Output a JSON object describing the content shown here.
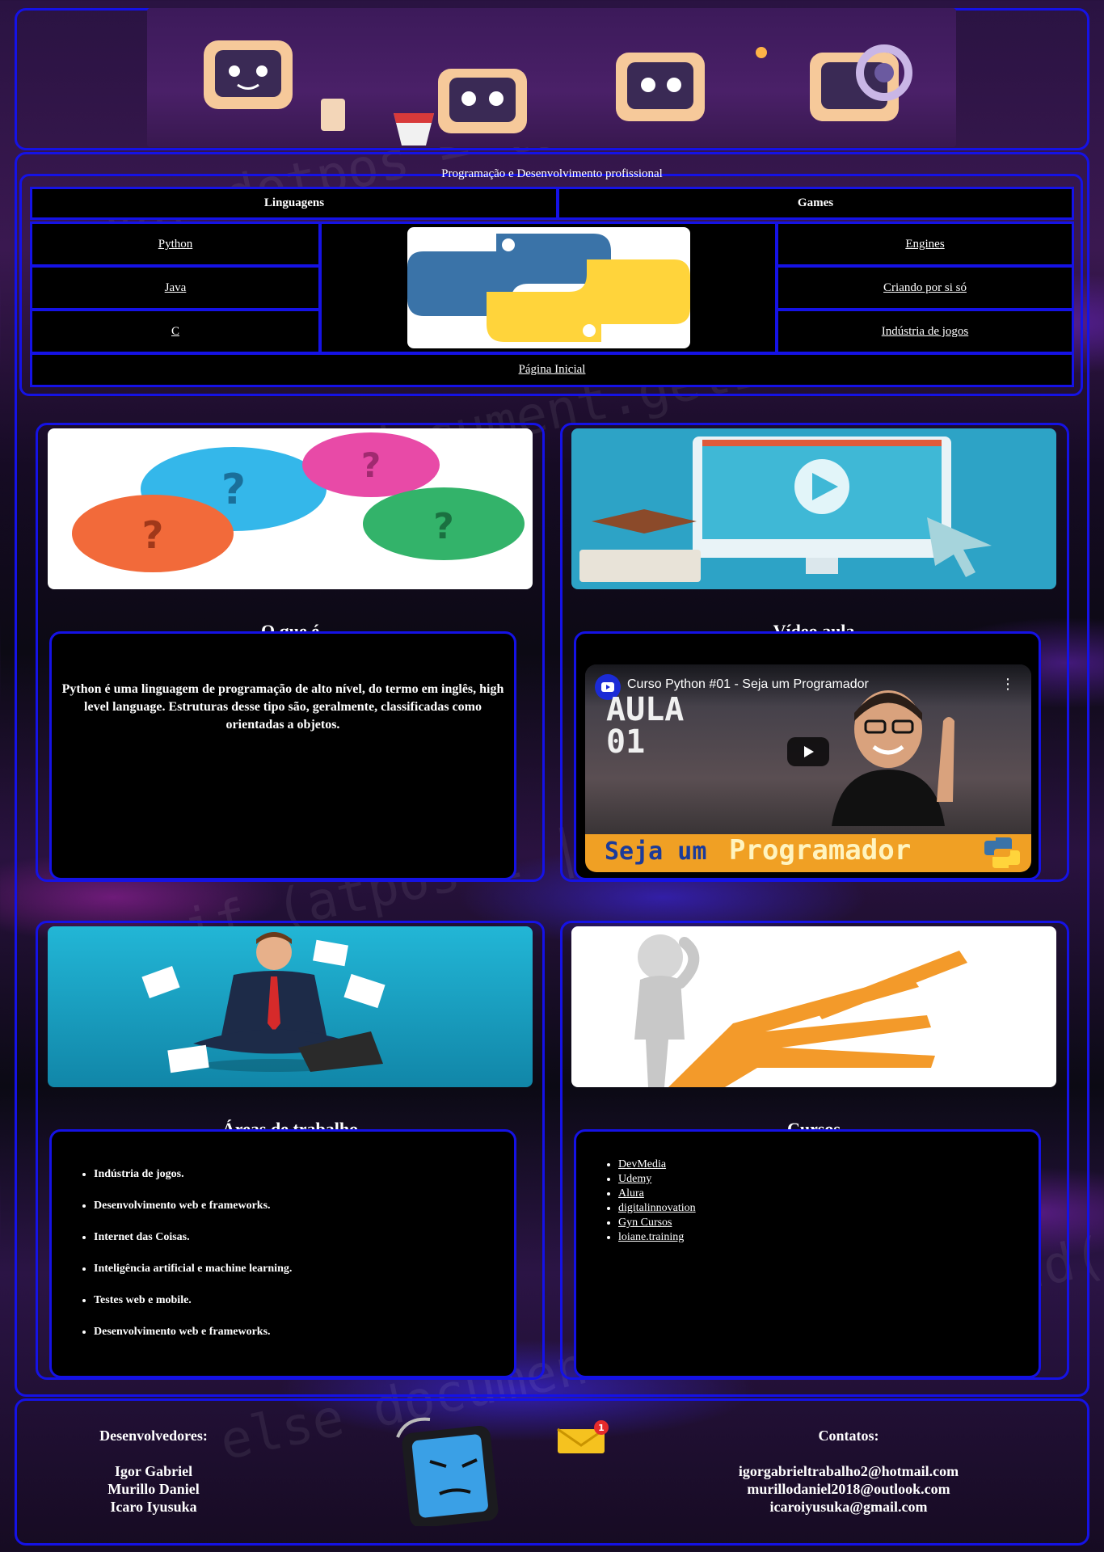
{
  "nav": {
    "title": "Programação e Desenvolvimento profissional",
    "col1_header": "Linguagens",
    "col2_header": "Games",
    "languages": [
      "Python",
      "Java",
      "C"
    ],
    "games": [
      "Engines",
      "Criando por si só",
      "Indústria de jogos"
    ],
    "home": "Página Inicial"
  },
  "background_code": [
    "var dotpos = lastpos",
    "else document.getElementById",
    "if (atpos<1 || dotpos",
    "else document.getElementById(id)"
  ],
  "about": {
    "heading": "O que é",
    "text": "Python é uma linguagem de programação de alto nível, do termo em inglês, high level language. Estruturas desse tipo são, geralmente, classificadas como orientadas a objetos."
  },
  "video": {
    "heading": "Vídeo aula",
    "title": "Curso Python #01 - Seja um Programador",
    "thumb_top": "AULA 01",
    "thumb_bottom_1": "Seja um",
    "thumb_bottom_2": "Programador"
  },
  "areas": {
    "heading": "Áreas de trabalho",
    "items": [
      "Indústria de jogos.",
      "Desenvolvimento web e frameworks.",
      "Internet das Coisas.",
      "Inteligência artificial e machine learning.",
      "Testes web e mobile.",
      "Desenvolvimento web e frameworks."
    ]
  },
  "courses": {
    "heading": "Cursos",
    "items": [
      "DevMedia",
      "Udemy",
      "Alura",
      "digitalinnovation",
      "Gyn Cursos",
      "loiane.training"
    ]
  },
  "footer": {
    "devs_label": "Desenvolvedores:",
    "devs": [
      "Igor Gabriel",
      "Murillo Daniel",
      "Icaro Iyusuka"
    ],
    "contacts_label": "Contatos:",
    "contacts": [
      "igorgabrieltrabalho2@hotmail.com",
      "murillodaniel2018@outlook.com",
      "icaroiyusuka@gmail.com"
    ],
    "mail_badge": "1"
  },
  "colors": {
    "border": "#1512e6",
    "python_blue": "#3a73a8",
    "python_yellow": "#ffd43b"
  }
}
